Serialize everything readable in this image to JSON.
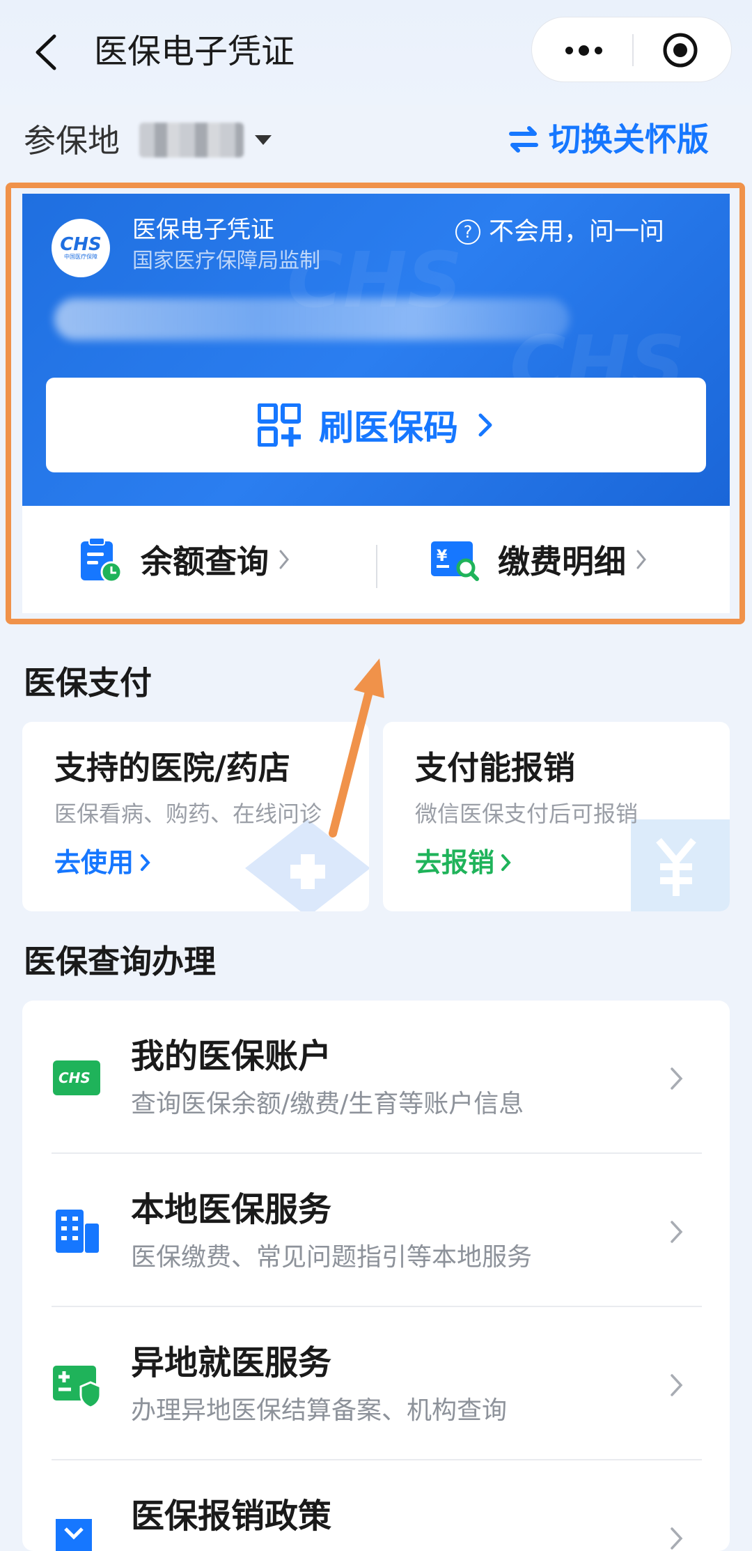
{
  "header": {
    "title": "医保电子凭证",
    "back_icon": "back-arrow-icon",
    "more_icon": "more-dots-icon",
    "close_icon": "mini-program-close-icon"
  },
  "location": {
    "label": "参保地",
    "switch_label": "切换关怀版"
  },
  "card": {
    "logo_text": "CHS",
    "logo_sub": "中国医疗保障",
    "title": "医保电子凭证",
    "subtitle": "国家医疗保障局监制",
    "help_label": "不会用，问一问",
    "scan_label": "刷医保码",
    "balance_label": "余额查询",
    "payment_label": "缴费明细"
  },
  "pay_section": {
    "title": "医保支付",
    "cards": [
      {
        "title": "支持的医院/药店",
        "desc": "医保看病、购药、在线问诊",
        "link": "去使用"
      },
      {
        "title": "支付能报销",
        "desc": "微信医保支付后可报销",
        "link": "去报销"
      }
    ]
  },
  "query_section": {
    "title": "医保查询办理",
    "items": [
      {
        "title": "我的医保账户",
        "subtitle": "查询医保余额/缴费/生育等账户信息"
      },
      {
        "title": "本地医保服务",
        "subtitle": "医保缴费、常见问题指引等本地服务"
      },
      {
        "title": "异地就医服务",
        "subtitle": "办理异地医保结算备案、机构查询"
      },
      {
        "title": "医保报销政策",
        "subtitle": ""
      }
    ]
  },
  "colors": {
    "accent": "#1677ff",
    "card_blue": "#2275e8",
    "green": "#1fb35a",
    "annotation_orange": "#f0924a"
  }
}
